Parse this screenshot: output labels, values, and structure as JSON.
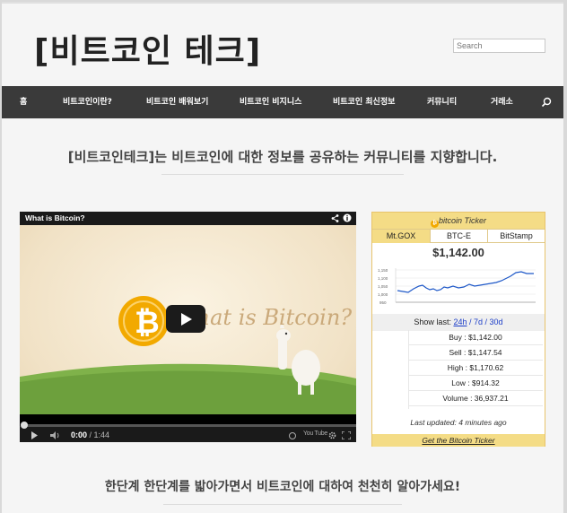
{
  "header": {
    "site_title": "[비트코인 테크]",
    "search_placeholder": "Search"
  },
  "nav": {
    "items": [
      {
        "label": "홈"
      },
      {
        "label": "비트코인이란?"
      },
      {
        "label": "비트코인 배워보기"
      },
      {
        "label": "비트코인 비지니스"
      },
      {
        "label": "비트코인 최신정보"
      },
      {
        "label": "커뮤니티"
      },
      {
        "label": "거래소"
      }
    ],
    "search_icon": "search-icon"
  },
  "main": {
    "tagline": "[비트코인테크]는 비트코인에 대한 정보를 공유하는 커뮤니티를 지향합니다.",
    "bottom_text": "한단계 한단계를 밟아가면서 비트코인에 대하여 천천히 알아가세요!"
  },
  "video": {
    "title": "What is Bitcoin?",
    "current_time": "0:00",
    "duration": "1:44",
    "logo_text": "You Tube",
    "overlay_text": "What is Bitcoin?"
  },
  "ticker": {
    "title": "bitcoin Ticker",
    "tabs": [
      {
        "label": "Mt.GOX",
        "active": true
      },
      {
        "label": "BTC-E",
        "active": false
      },
      {
        "label": "BitStamp",
        "active": false
      }
    ],
    "price": "$1,142.00",
    "chart_ticks": [
      "1,150",
      "1,100",
      "1,050",
      "1,000",
      "950"
    ],
    "show_last_label": "Show last:",
    "ranges": [
      "24h",
      "7d",
      "30d"
    ],
    "rows": [
      {
        "label": "Buy : $1,142.00"
      },
      {
        "label": "Sell : $1,147.54"
      },
      {
        "label": "High : $1,170.62"
      },
      {
        "label": "Low : $914.32"
      },
      {
        "label": "Volume : 36,937.21"
      }
    ],
    "updated": "Last updated: 4 minutes ago",
    "footer_link": "Get the Bitcoin Ticker"
  },
  "colors": {
    "nav_bg": "#3a3a3a",
    "ticker_gold": "#f4dc86",
    "bitcoin_orange": "#f2a900",
    "link_blue": "#1a3cc8"
  }
}
